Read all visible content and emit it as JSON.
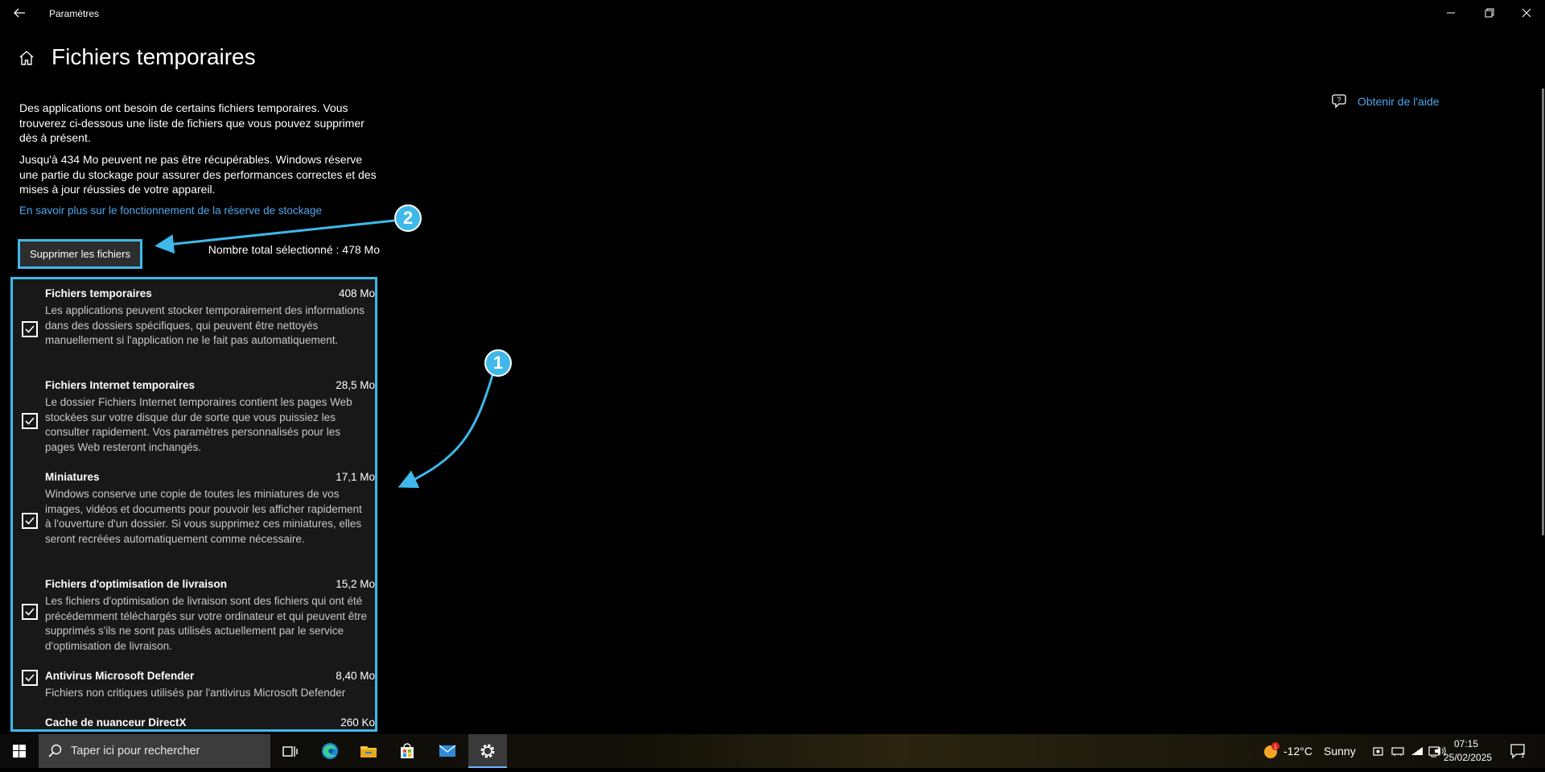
{
  "window": {
    "title": "Paramètres",
    "back_icon": "back-arrow-icon",
    "controls": [
      "minimize-icon",
      "restore-icon",
      "close-icon"
    ]
  },
  "header": {
    "home_icon": "home-icon",
    "title": "Fichiers temporaires"
  },
  "intro": {
    "paragraph1": "Des applications ont besoin de certains fichiers temporaires. Vous trouverez ci-dessous une liste de fichiers que vous pouvez supprimer dès à présent.",
    "paragraph2": "Jusqu'à 434 Mo peuvent ne pas être récupérables. Windows réserve une partie du stockage pour assurer des performances correctes et des mises à jour réussies de votre appareil.",
    "link": "En savoir plus sur le fonctionnement de la réserve de stockage"
  },
  "help": {
    "label": "Obtenir de l'aide",
    "icon": "help-chat-icon"
  },
  "actions": {
    "delete_button": "Supprimer les fichiers",
    "total_selected": "Nombre total sélectionné : 478 Mo"
  },
  "items": [
    {
      "title": "Fichiers temporaires",
      "size": "408 Mo",
      "checked": true,
      "desc": "Les applications peuvent stocker temporairement des informations dans des dossiers spécifiques, qui peuvent être nettoyés manuellement si l'application ne le fait pas automatiquement."
    },
    {
      "title": "Fichiers Internet temporaires",
      "size": "28,5 Mo",
      "checked": true,
      "desc": "Le dossier Fichiers Internet temporaires contient les pages Web stockées sur votre disque dur de sorte que vous puissiez les consulter rapidement. Vos paramètres personnalisés pour les pages Web resteront inchangés."
    },
    {
      "title": "Miniatures",
      "size": "17,1 Mo",
      "checked": true,
      "desc": "Windows conserve une copie de toutes les miniatures de vos images, vidéos et documents pour pouvoir les afficher rapidement à l'ouverture d'un dossier. Si vous supprimez ces miniatures, elles seront recréées automatiquement comme nécessaire."
    },
    {
      "title": "Fichiers d'optimisation de livraison",
      "size": "15,2 Mo",
      "checked": true,
      "desc": "Les fichiers d'optimisation de livraison sont des fichiers qui ont été précédemment téléchargés sur votre ordinateur et qui peuvent être supprimés s'ils ne sont pas utilisés actuellement par le service d'optimisation de livraison."
    },
    {
      "title": "Antivirus Microsoft Defender",
      "size": "8,40 Mo",
      "checked": true,
      "desc": "Fichiers non critiques utilisés par l'antivirus Microsoft Defender"
    },
    {
      "title": "Cache de nuanceur DirectX",
      "size": "260 Ko",
      "checked": true,
      "desc": ""
    }
  ],
  "annotations": {
    "badge1": "1",
    "badge2": "2",
    "color": "#3fb9ea"
  },
  "taskbar": {
    "search_placeholder": "Taper ici pour rechercher",
    "apps": [
      "task-view-icon",
      "edge-icon",
      "file-explorer-icon",
      "store-icon",
      "mail-icon",
      "settings-icon"
    ],
    "weather_temp": "-12°C",
    "weather_condition": "Sunny",
    "weather_badge": "1",
    "time": "07:15",
    "date": "25/02/2025",
    "notification_count": "1"
  }
}
